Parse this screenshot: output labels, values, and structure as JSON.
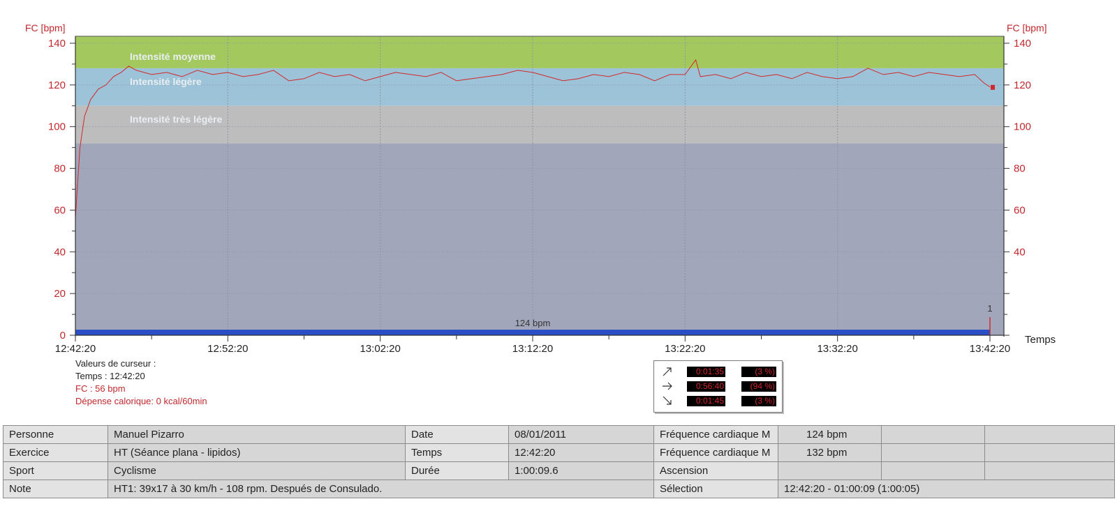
{
  "chart_data": {
    "type": "line",
    "title": "",
    "ylabel_left": "FC [bpm]",
    "ylabel_right": "FC [bpm]",
    "xlabel": "Temps",
    "ylim": [
      0,
      140
    ],
    "y_ticks_left": [
      0,
      20,
      40,
      60,
      80,
      100,
      120,
      140
    ],
    "y_ticks_right": [
      40,
      60,
      80,
      100,
      120,
      140
    ],
    "x_ticks": [
      "12:42:20",
      "12:52:20",
      "13:02:20",
      "13:12:20",
      "13:22:20",
      "13:32:20",
      "13:42:20"
    ],
    "x_range_minutes": [
      0,
      60
    ],
    "grid": true,
    "zones": [
      {
        "name": "Intensité moyenne",
        "from": 128,
        "to": 140,
        "color": "#a3c95e"
      },
      {
        "name": "Intensité légère",
        "from": 110,
        "to": 128,
        "color": "#9cc3d7"
      },
      {
        "name": "Intensité très légère",
        "from": 92,
        "to": 110,
        "color": "#bdbdbd"
      },
      {
        "name": "",
        "from": 0,
        "to": 92,
        "color": "#a2a6bb"
      }
    ],
    "series": [
      {
        "name": "FC",
        "color": "#d2282d",
        "x_minutes": [
          0,
          0.3,
          0.6,
          1.0,
          1.5,
          2.0,
          2.5,
          3.0,
          3.5,
          4.0,
          5.0,
          6.0,
          7.0,
          8.0,
          9.0,
          10.0,
          11.0,
          12.0,
          13.0,
          14.0,
          15.0,
          16.0,
          17.0,
          18.0,
          19.0,
          20.0,
          21.0,
          22.0,
          23.0,
          24.0,
          25.0,
          26.0,
          27.0,
          28.0,
          29.0,
          30.0,
          31.0,
          32.0,
          33.0,
          34.0,
          35.0,
          36.0,
          37.0,
          38.0,
          39.0,
          40.0,
          40.7,
          41.0,
          42.0,
          43.0,
          44.0,
          45.0,
          46.0,
          47.0,
          48.0,
          49.0,
          50.0,
          51.0,
          52.0,
          53.0,
          54.0,
          55.0,
          56.0,
          57.0,
          58.0,
          59.0,
          59.6,
          60.0
        ],
        "values": [
          56,
          90,
          105,
          113,
          118,
          120,
          124,
          126,
          129,
          127,
          125,
          126,
          124,
          127,
          125,
          126,
          124,
          125,
          127,
          122,
          123,
          126,
          124,
          125,
          122,
          124,
          126,
          125,
          124,
          126,
          122,
          123,
          124,
          125,
          127,
          126,
          124,
          122,
          123,
          125,
          124,
          126,
          125,
          122,
          125,
          125,
          132,
          124,
          125,
          123,
          126,
          124,
          125,
          123,
          126,
          124,
          123,
          124,
          128,
          125,
          126,
          124,
          126,
          125,
          124,
          125,
          121,
          119
        ]
      }
    ],
    "bar_label": "124 bpm",
    "marker_label": "1",
    "marker_x_minutes": 60
  },
  "cursor_values": {
    "title": "Valeurs de curseur :",
    "time": "Temps : 12:42:20",
    "fc": "FC : 56 bpm",
    "calories": "Dépense calorique: 0 kcal/60min"
  },
  "zone_summary": [
    {
      "icon": "arrow-up-right-icon",
      "time": "0:01:35",
      "pct": "(3 %)"
    },
    {
      "icon": "arrow-right-icon",
      "time": "0:56:40",
      "pct": "(94 %)"
    },
    {
      "icon": "arrow-down-right-icon",
      "time": "0:01:45",
      "pct": "(3 %)"
    }
  ],
  "info_table": {
    "rows": [
      [
        "Personne",
        "Manuel Pizarro",
        "Date",
        "08/01/2011",
        "Fréquence cardiaque M",
        "124 bpm",
        "",
        ""
      ],
      [
        "Exercice",
        "HT (Séance plana - lipidos)",
        "Temps",
        "12:42:20",
        "Fréquence cardiaque M",
        "132 bpm",
        "",
        ""
      ],
      [
        "Sport",
        "Cyclisme",
        "Durée",
        "1:00:09.6",
        "Ascension",
        "",
        "",
        ""
      ]
    ],
    "note_label": "Note",
    "note_value": "HT1: 39x17 à 30 km/h - 108 rpm. Después de Consulado.",
    "selection_label": "Sélection",
    "selection_value": "12:42:20 - 01:00:09 (1:00:05)"
  }
}
